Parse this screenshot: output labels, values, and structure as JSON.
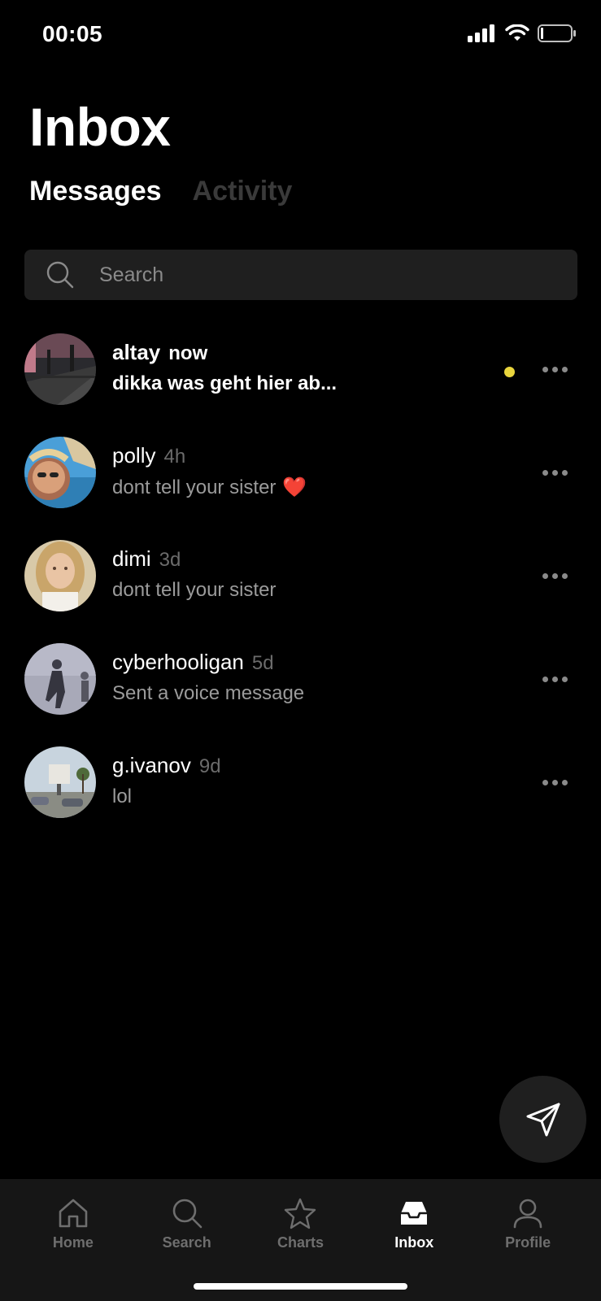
{
  "status_bar": {
    "time": "00:05",
    "icons": [
      "cellular-signal-icon",
      "wifi-icon",
      "battery-icon"
    ]
  },
  "page": {
    "title": "Inbox"
  },
  "tabs": [
    {
      "label": "Messages",
      "active": true
    },
    {
      "label": "Activity",
      "active": false
    }
  ],
  "search": {
    "placeholder": "Search",
    "value": ""
  },
  "conversations": [
    {
      "name": "altay",
      "time": "now",
      "preview": "dikka was geht hier ab...",
      "unread": true,
      "avatar": "avatar-photo"
    },
    {
      "name": "polly",
      "time": "4h",
      "preview": "dont tell your sister",
      "emoji": "❤️",
      "unread": false,
      "avatar": "avatar-photo"
    },
    {
      "name": "dimi",
      "time": "3d",
      "preview": "dont tell your sister",
      "unread": false,
      "avatar": "avatar-photo"
    },
    {
      "name": "cyberhooligan",
      "time": "5d",
      "preview": "Sent a voice message",
      "unread": false,
      "avatar": "avatar-photo"
    },
    {
      "name": "g.ivanov",
      "time": "9d",
      "preview": "lol",
      "unread": false,
      "avatar": "avatar-photo"
    }
  ],
  "compose_button": {
    "icon": "paper-plane-icon"
  },
  "bottom_nav": {
    "items": [
      {
        "label": "Home",
        "icon": "home-icon",
        "active": false
      },
      {
        "label": "Search",
        "icon": "search-icon",
        "active": false
      },
      {
        "label": "Charts",
        "icon": "star-icon",
        "active": false
      },
      {
        "label": "Inbox",
        "icon": "inbox-tray-icon",
        "active": true
      },
      {
        "label": "Profile",
        "icon": "person-icon",
        "active": false
      }
    ]
  },
  "colors": {
    "background": "#000000",
    "surface": "#1f1f1f",
    "tab_bar": "#161616",
    "unread_dot": "#e9d53d",
    "muted_text": "#9b9b9b",
    "inactive_tab": "#3a3a3a"
  }
}
